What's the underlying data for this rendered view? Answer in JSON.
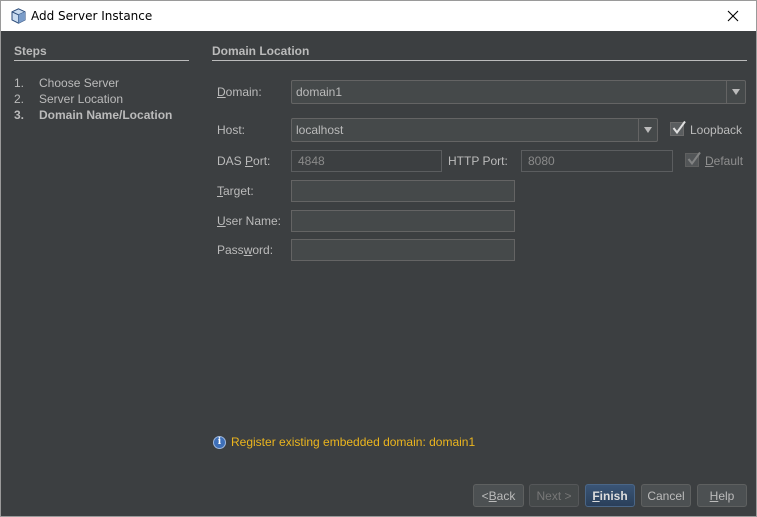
{
  "window": {
    "title": "Add Server Instance",
    "icon": "server-cube-icon",
    "close_icon": "close-icon"
  },
  "steps": {
    "title": "Steps",
    "items": [
      {
        "num": "1.",
        "label": "Choose Server",
        "current": false
      },
      {
        "num": "2.",
        "label": "Server Location",
        "current": false
      },
      {
        "num": "3.",
        "label": "Domain Name/Location",
        "current": true
      }
    ]
  },
  "panel": {
    "title": "Domain Location",
    "domain": {
      "label_mnemonic": "D",
      "label_rest": "omain:",
      "value": "domain1"
    },
    "host": {
      "label": "Host:",
      "value": "localhost"
    },
    "loopback": {
      "label": "Loopback",
      "checked": true
    },
    "das_port": {
      "label_pre": "DAS ",
      "label_mnemonic": "P",
      "label_rest": "ort:",
      "value": "4848"
    },
    "http_port": {
      "label": "HTTP Port:",
      "value": "8080"
    },
    "default": {
      "label_mnemonic": "D",
      "label_rest": "efault",
      "checked": true,
      "enabled": false
    },
    "target": {
      "label_mnemonic": "T",
      "label_rest": "arget:",
      "value": ""
    },
    "user_name": {
      "label_mnemonic": "U",
      "label_rest": "ser Name:",
      "value": ""
    },
    "password": {
      "label_pre": "Pass",
      "label_mnemonic": "w",
      "label_rest": "ord:",
      "value": ""
    }
  },
  "info": {
    "icon": "info-icon",
    "glyph": "i",
    "message": "Register existing embedded domain: domain1",
    "color": "#ebb51e"
  },
  "buttons": {
    "back": {
      "pre": "< ",
      "mnemonic": "B",
      "rest": "ack",
      "enabled": true
    },
    "next": {
      "label": "Next >",
      "enabled": false
    },
    "finish": {
      "mnemonic": "F",
      "rest": "inish",
      "enabled": true
    },
    "cancel": {
      "label": "Cancel",
      "enabled": true
    },
    "help": {
      "mnemonic": "H",
      "rest": "elp",
      "enabled": true
    }
  }
}
